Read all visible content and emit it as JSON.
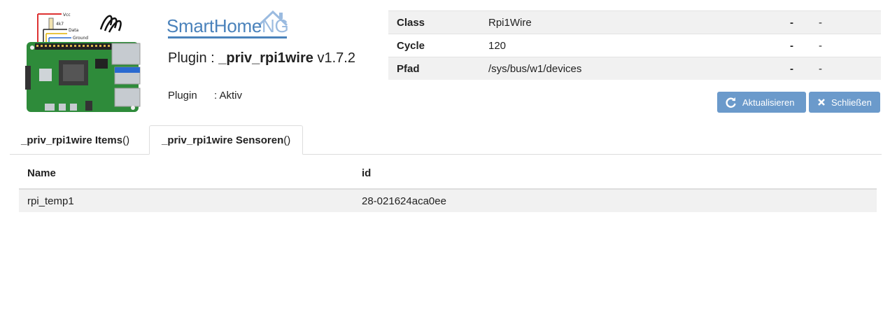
{
  "brand": {
    "name_main": "SmartHome",
    "name_suffix": "NG"
  },
  "plugin": {
    "title_prefix": "Plugin : ",
    "name": "_priv_rpi1wire",
    "version": "v1.7.2",
    "status_label": "Plugin",
    "status_value": ": Aktiv",
    "image_labels": {
      "vcc": "Vcc",
      "resistor": "4k7",
      "data": "Data",
      "ground": "Ground"
    }
  },
  "info": {
    "rows": [
      {
        "key": "Class",
        "value": "Rpi1Wire",
        "dash1": "-",
        "dash2": "-"
      },
      {
        "key": "Cycle",
        "value": "120",
        "dash1": "-",
        "dash2": "-"
      },
      {
        "key": "Pfad",
        "value": "/sys/bus/w1/devices",
        "dash1": "-",
        "dash2": "-"
      }
    ]
  },
  "buttons": {
    "refresh": "Aktualisieren",
    "close": "Schließen"
  },
  "tabs": [
    {
      "label": "_priv_rpi1wire Items",
      "count": " ()"
    },
    {
      "label": "_priv_rpi1wire Sensoren",
      "count": " ()"
    }
  ],
  "sensors": {
    "headers": [
      "Name",
      "id"
    ],
    "rows": [
      {
        "name": "rpi_temp1",
        "id": "28-021624aca0ee"
      }
    ]
  },
  "colors": {
    "button": "#6b9acb",
    "brand": "#4a82bb",
    "row_alt": "#f1f1f1"
  }
}
